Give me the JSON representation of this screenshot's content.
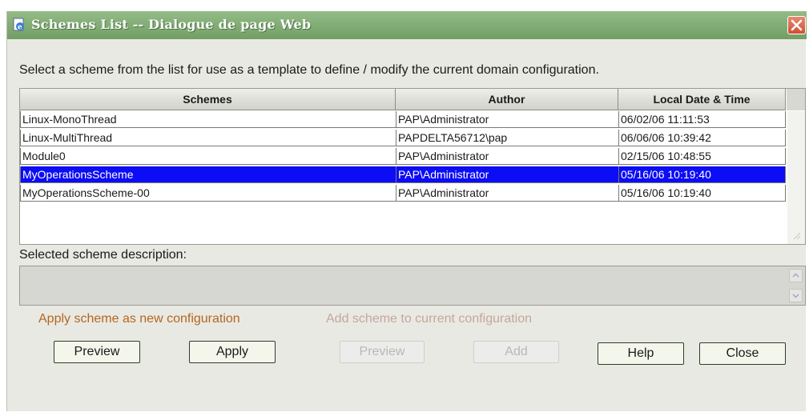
{
  "window": {
    "title": "Schemes List -- Dialogue de page Web",
    "icon": "ie-page-icon",
    "close_icon": "close-x-icon"
  },
  "instruction": "Select a scheme from the list for use as a template to define / modify the current domain configuration.",
  "table": {
    "columns": [
      "Schemes",
      "Author",
      "Local Date & Time"
    ],
    "rows": [
      {
        "scheme": "Linux-MonoThread",
        "author": "PAP\\Administrator",
        "datetime": "06/02/06 11:11:53",
        "selected": false
      },
      {
        "scheme": "Linux-MultiThread",
        "author": "PAPDELTA56712\\pap",
        "datetime": "06/06/06 10:39:42",
        "selected": false
      },
      {
        "scheme": "Module0",
        "author": "PAP\\Administrator",
        "datetime": "02/15/06 10:48:55",
        "selected": false
      },
      {
        "scheme": "MyOperationsScheme",
        "author": "PAP\\Administrator",
        "datetime": "05/16/06 10:19:40",
        "selected": true
      },
      {
        "scheme": "MyOperationsScheme-00",
        "author": "PAP\\Administrator",
        "datetime": "05/16/06 10:19:40",
        "selected": false
      }
    ]
  },
  "description": {
    "label": "Selected scheme description:",
    "value": ""
  },
  "apply_section": {
    "label": "Apply scheme as new configuration",
    "preview_label": "Preview",
    "apply_label": "Apply"
  },
  "add_section": {
    "label": "Add scheme to current configuration",
    "preview_label": "Preview",
    "add_label": "Add"
  },
  "footer": {
    "help_label": "Help",
    "close_label": "Close"
  },
  "colors": {
    "titlebar": "#7faa72",
    "selection": "#0c0cf5",
    "apply_label": "#b3671f",
    "disabled_label": "#c4a79a"
  }
}
